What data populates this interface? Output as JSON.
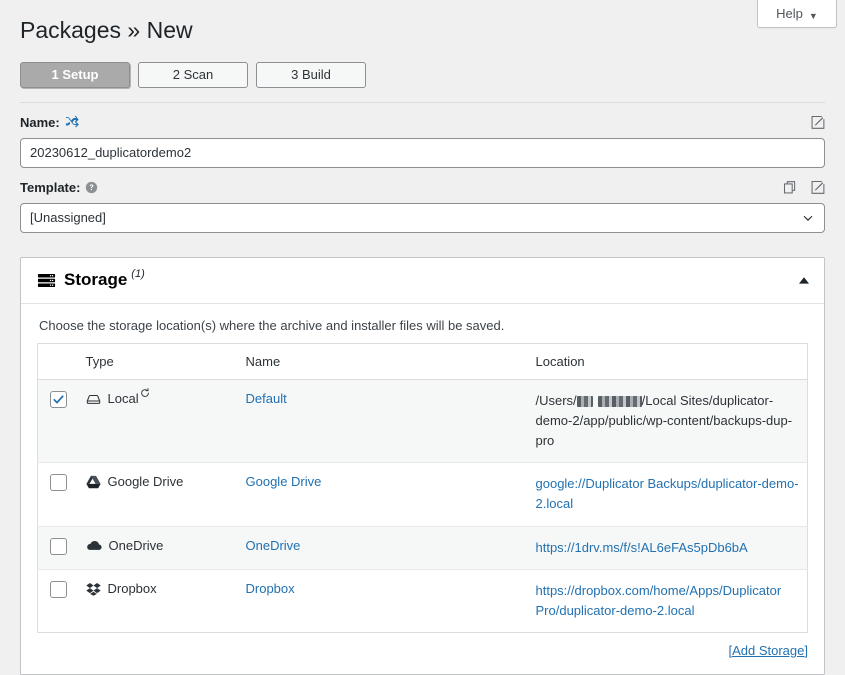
{
  "header": {
    "help_label": "Help",
    "help_caret": "▼",
    "title": "Packages » New"
  },
  "tabs": [
    {
      "label": "1 Setup",
      "active": true
    },
    {
      "label": "2 Scan",
      "active": false
    },
    {
      "label": "3 Build",
      "active": false
    }
  ],
  "fields": {
    "name": {
      "label": "Name:",
      "icon": "shuffle-icon",
      "value": "20230612_duplicatordemo2",
      "edit_icon": "edit-pencil-icon"
    },
    "template": {
      "label": "Template:",
      "icon": "help-circle-icon",
      "value": "[Unassigned]",
      "copy_icon": "copy-icon",
      "edit_icon": "edit-pencil-icon",
      "dropdown_icon": "chevron-down-icon"
    }
  },
  "storage": {
    "icon": "server-stack-icon",
    "title": "Storage",
    "count": "(1)",
    "toggle_icon": "triangle-up-icon",
    "description": "Choose the storage location(s) where the archive and installer files will be saved.",
    "columns": [
      "",
      "Type",
      "Name",
      "Location"
    ],
    "rows": [
      {
        "checked": true,
        "type_icon": "hard-drive-icon",
        "type": "Local",
        "has_refresh": true,
        "refresh_icon": "refresh-arrow-icon",
        "name": "Default",
        "location_prefix": "/Users/",
        "location_redacted": true,
        "location_suffix": "/Local Sites/duplicator-demo-2/app/public/wp-content/backups-dup-pro",
        "location_is_link": false
      },
      {
        "checked": false,
        "type_icon": "google-drive-icon",
        "type": "Google Drive",
        "has_refresh": false,
        "name": "Google Drive",
        "location": "google://Duplicator Backups/duplicator-demo-2.local",
        "location_is_link": true
      },
      {
        "checked": false,
        "type_icon": "onedrive-cloud-icon",
        "type": "OneDrive",
        "has_refresh": false,
        "name": "OneDrive",
        "location": "https://1drv.ms/f/s!AL6eFAs5pDb6bA",
        "location_is_link": true
      },
      {
        "checked": false,
        "type_icon": "dropbox-icon",
        "type": "Dropbox",
        "has_refresh": false,
        "name": "Dropbox",
        "location": "https://dropbox.com/home/Apps/Duplicator Pro/duplicator-demo-2.local",
        "location_is_link": true
      }
    ],
    "add_storage_label": "Add Storage",
    "add_storage_bracket_open": "[",
    "add_storage_bracket_close": "]"
  },
  "colors": {
    "link": "#2271b1",
    "page_bg": "#f0f0f1",
    "panel_bg": "#ffffff",
    "active_tab_bg": "#aaaaaa",
    "check_blue": "#2271b1"
  }
}
